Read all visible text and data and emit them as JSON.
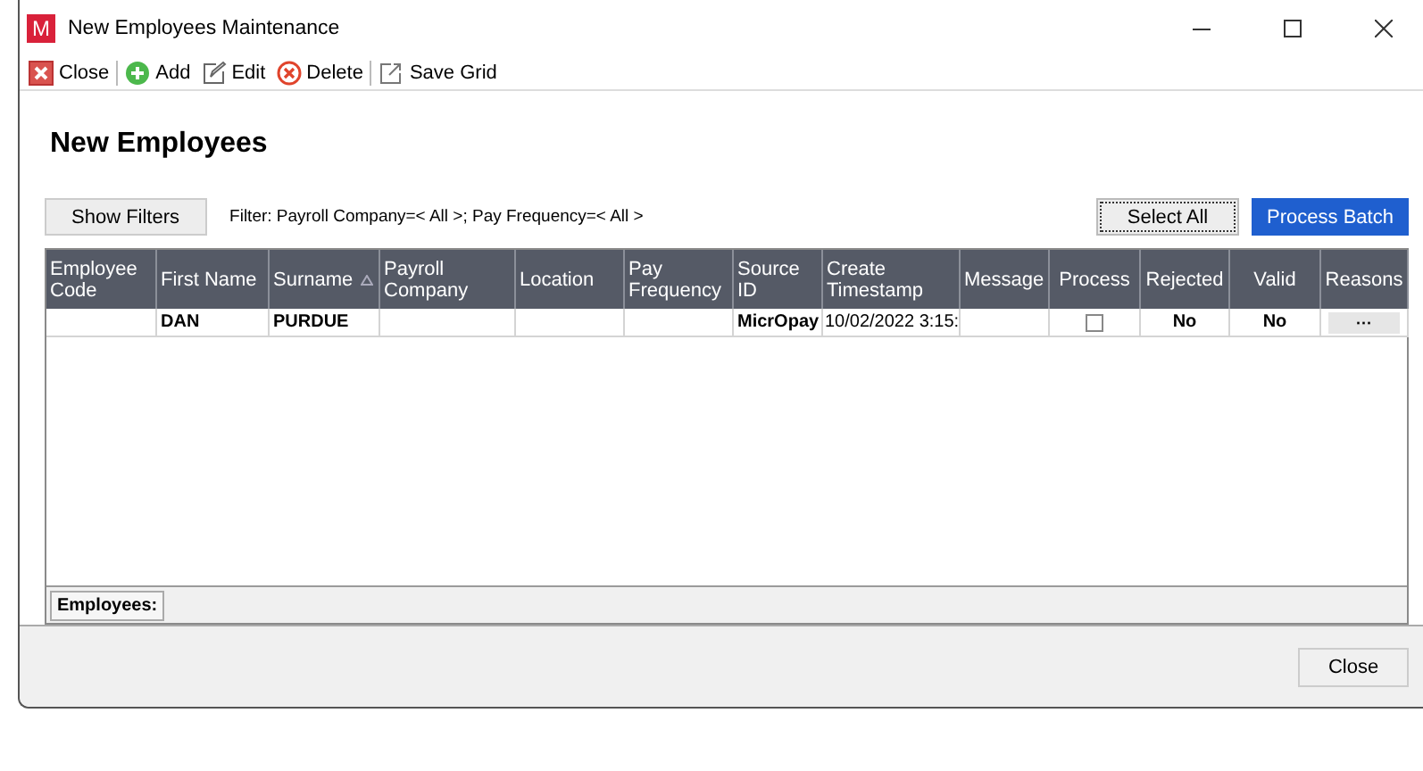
{
  "window": {
    "title": "New Employees Maintenance",
    "app_icon": "M"
  },
  "toolbar": [
    {
      "label": "Close"
    },
    {
      "label": "Add"
    },
    {
      "label": "Edit"
    },
    {
      "label": "Delete"
    },
    {
      "label": "Save Grid"
    }
  ],
  "heading": "New Employees",
  "filters": {
    "button": "Show Filters",
    "text": "Filter: Payroll Company=< All >; Pay Frequency=< All >"
  },
  "actions": [
    {
      "label": "Select All",
      "kind": "focused"
    },
    {
      "label": "Process Batch",
      "kind": "primary"
    }
  ],
  "grid": {
    "columns": [
      {
        "label": "Employee Code",
        "sorted": false
      },
      {
        "label": "First Name",
        "sorted": false
      },
      {
        "label": "Surname",
        "sorted": true
      },
      {
        "label": "Payroll Company",
        "sorted": false
      },
      {
        "label": "Location",
        "sorted": false
      },
      {
        "label": "Pay Frequency",
        "sorted": false
      },
      {
        "label": "Source ID",
        "sorted": false
      },
      {
        "label": "Create Timestamp",
        "sorted": false
      },
      {
        "label": "Message",
        "sorted": false
      },
      {
        "label": "Process",
        "sorted": false
      },
      {
        "label": "Rejected",
        "sorted": false
      },
      {
        "label": "Valid",
        "sorted": false
      },
      {
        "label": "Reasons",
        "sorted": false
      }
    ],
    "rows": [
      [
        {
          "kind": "text",
          "text": ""
        },
        {
          "kind": "text",
          "text": "DAN"
        },
        {
          "kind": "text",
          "text": "PURDUE"
        },
        {
          "kind": "text",
          "text": ""
        },
        {
          "kind": "text",
          "text": ""
        },
        {
          "kind": "text",
          "text": ""
        },
        {
          "kind": "text",
          "text": "MicrOpay"
        },
        {
          "kind": "plain",
          "text": "10/02/2022 3:15:"
        },
        {
          "kind": "text",
          "text": ""
        },
        {
          "kind": "checkbox",
          "checked": false
        },
        {
          "kind": "center",
          "text": "No"
        },
        {
          "kind": "center",
          "text": "No"
        },
        {
          "kind": "button",
          "text": "···"
        }
      ]
    ],
    "footer_tab": "Employees:"
  },
  "footer_button": "Close"
}
